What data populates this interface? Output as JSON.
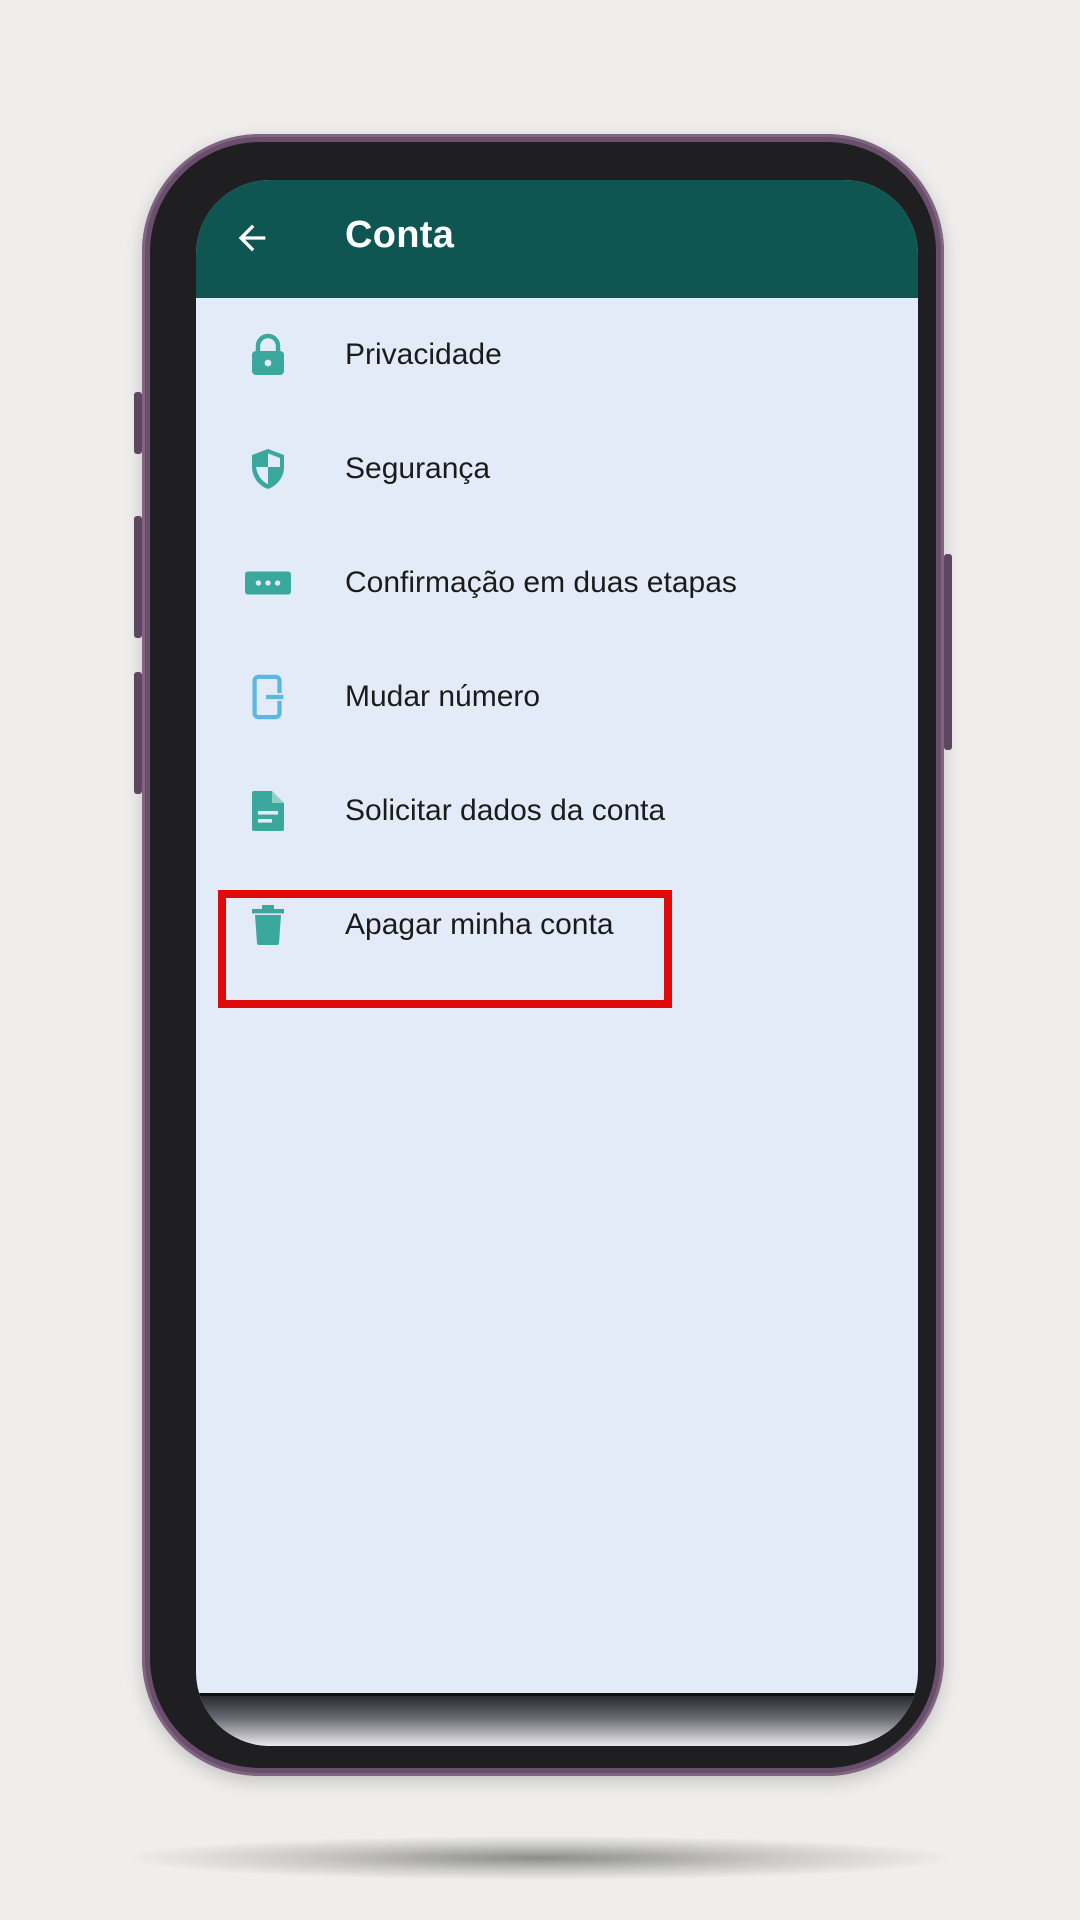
{
  "appbar": {
    "title": "Conta",
    "back_icon": "arrow-left-icon",
    "background": "#0f5552"
  },
  "menu": {
    "items": [
      {
        "label": "Privacidade",
        "icon": "lock-icon"
      },
      {
        "label": "Segurança",
        "icon": "shield-icon"
      },
      {
        "label": "Confirmação em duas etapas",
        "icon": "dots-password-icon"
      },
      {
        "label": "Mudar número",
        "icon": "change-number-icon"
      },
      {
        "label": "Solicitar dados da conta",
        "icon": "document-icon"
      },
      {
        "label": "Apagar minha conta",
        "icon": "trash-icon"
      }
    ]
  },
  "colors": {
    "icon": "#3aa89d",
    "screen_bg": "#e3ebf9",
    "highlight": "#e00a0a"
  }
}
